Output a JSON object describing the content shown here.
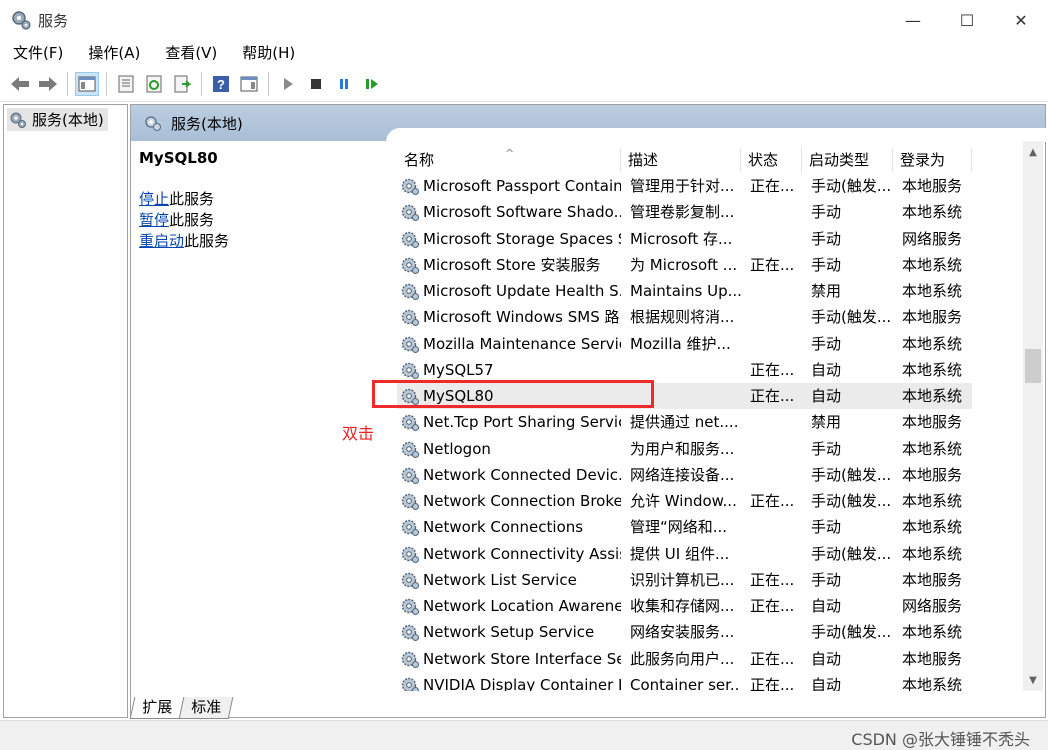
{
  "window": {
    "title": "服务",
    "minimize": "—",
    "maximize": "☐",
    "close": "✕"
  },
  "menu": [
    {
      "label": "文件(F)"
    },
    {
      "label": "操作(A)"
    },
    {
      "label": "查看(V)"
    },
    {
      "label": "帮助(H)"
    }
  ],
  "tree": {
    "item": "服务(本地)"
  },
  "panel": {
    "header": "服务(本地)",
    "selected_service": "MySQL80",
    "actions": [
      {
        "link": "停止",
        "rest": "此服务"
      },
      {
        "link": "暂停",
        "rest": "此服务"
      },
      {
        "link": "重启动",
        "rest": "此服务"
      }
    ]
  },
  "columns": [
    "名称",
    "描述",
    "状态",
    "启动类型",
    "登录为"
  ],
  "rows": [
    {
      "name": "Microsoft Passport Container",
      "desc": "管理用于针对...",
      "status": "正在...",
      "startup": "手动(触发...",
      "logon": "本地服务"
    },
    {
      "name": "Microsoft Software Shado...",
      "desc": "管理卷影复制...",
      "status": "",
      "startup": "手动",
      "logon": "本地系统"
    },
    {
      "name": "Microsoft Storage Spaces S...",
      "desc": "Microsoft 存...",
      "status": "",
      "startup": "手动",
      "logon": "网络服务"
    },
    {
      "name": "Microsoft Store 安装服务",
      "desc": "为 Microsoft ...",
      "status": "正在...",
      "startup": "手动",
      "logon": "本地系统"
    },
    {
      "name": "Microsoft Update Health S...",
      "desc": "Maintains Up...",
      "status": "",
      "startup": "禁用",
      "logon": "本地系统"
    },
    {
      "name": "Microsoft Windows SMS 路...",
      "desc": "根据规则将消...",
      "status": "",
      "startup": "手动(触发...",
      "logon": "本地服务"
    },
    {
      "name": "Mozilla Maintenance Service",
      "desc": "Mozilla 维护...",
      "status": "",
      "startup": "手动",
      "logon": "本地系统"
    },
    {
      "name": "MySQL57",
      "desc": "",
      "status": "正在...",
      "startup": "自动",
      "logon": "本地系统"
    },
    {
      "name": "MySQL80",
      "desc": "",
      "status": "正在...",
      "startup": "自动",
      "logon": "本地系统",
      "selected": true
    },
    {
      "name": "Net.Tcp Port Sharing Service",
      "desc": "提供通过 net....",
      "status": "",
      "startup": "禁用",
      "logon": "本地服务"
    },
    {
      "name": "Netlogon",
      "desc": "为用户和服务...",
      "status": "",
      "startup": "手动",
      "logon": "本地系统"
    },
    {
      "name": "Network Connected Devic...",
      "desc": "网络连接设备...",
      "status": "",
      "startup": "手动(触发...",
      "logon": "本地服务"
    },
    {
      "name": "Network Connection Broker",
      "desc": "允许 Window...",
      "status": "正在...",
      "startup": "手动(触发...",
      "logon": "本地系统"
    },
    {
      "name": "Network Connections",
      "desc": "管理“网络和...",
      "status": "",
      "startup": "手动",
      "logon": "本地系统"
    },
    {
      "name": "Network Connectivity Assis...",
      "desc": "提供 UI 组件...",
      "status": "",
      "startup": "手动(触发...",
      "logon": "本地系统"
    },
    {
      "name": "Network List Service",
      "desc": "识别计算机已...",
      "status": "正在...",
      "startup": "手动",
      "logon": "本地服务"
    },
    {
      "name": "Network Location Awarene...",
      "desc": "收集和存储网...",
      "status": "正在...",
      "startup": "自动",
      "logon": "网络服务"
    },
    {
      "name": "Network Setup Service",
      "desc": "网络安装服务...",
      "status": "",
      "startup": "手动(触发...",
      "logon": "本地系统"
    },
    {
      "name": "Network Store Interface Se...",
      "desc": "此服务向用户...",
      "status": "正在...",
      "startup": "自动",
      "logon": "本地服务"
    },
    {
      "name": "NVIDIA Display Container LS",
      "desc": "Container ser...",
      "status": "正在...",
      "startup": "自动",
      "logon": "本地系统"
    }
  ],
  "tabs": [
    {
      "label": "扩展"
    },
    {
      "label": "标准"
    }
  ],
  "annotation": {
    "text": "双击"
  },
  "watermark": "CSDN @张大锤锤不秃头"
}
